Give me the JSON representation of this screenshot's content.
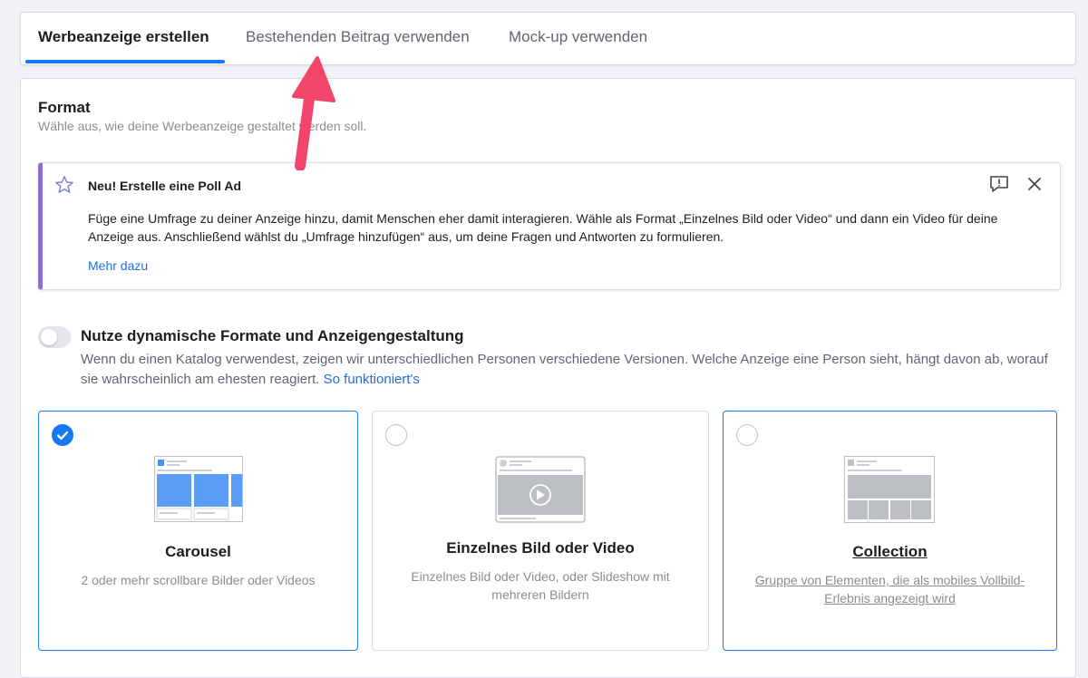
{
  "tabs": [
    {
      "label": "Werbeanzeige erstellen",
      "active": true
    },
    {
      "label": "Bestehenden Beitrag verwenden",
      "active": false
    },
    {
      "label": "Mock-up verwenden",
      "active": false
    }
  ],
  "format": {
    "title": "Format",
    "subtitle": "Wähle aus, wie deine Werbeanzeige gestaltet werden soll."
  },
  "notice": {
    "title": "Neu! Erstelle eine Poll Ad",
    "text": "Füge eine Umfrage zu deiner Anzeige hinzu, damit Menschen eher damit interagieren. Wähle als Format „Einzelnes Bild oder Video“ und dann ein Video für deine Anzeige aus. Anschließend wählst du „Umfrage hinzufügen“ aus, um deine Fragen und Antworten zu formulieren.",
    "link": "Mehr dazu",
    "accent_color": "#8c6fd6"
  },
  "dynamic": {
    "title": "Nutze dynamische Formate und Anzeigengestaltung",
    "description": "Wenn du einen Katalog verwendest, zeigen wir unterschiedlichen Personen verschiedene Versionen. Welche Anzeige eine Person sieht, hängt davon ab, worauf sie wahrscheinlich am ehesten reagiert.",
    "link": "So funktioniert's",
    "enabled": false
  },
  "options": [
    {
      "title": "Carousel",
      "description": "2 oder mehr scrollbare Bilder oder Videos",
      "selected": true,
      "icon": "carousel-thumbnail"
    },
    {
      "title": "Einzelnes Bild oder Video",
      "description": "Einzelnes Bild oder Video, oder Slideshow mit mehreren Bildern",
      "selected": false,
      "icon": "single-video-thumbnail"
    },
    {
      "title": "Collection",
      "description": "Gruppe von Elementen, die als mobiles Vollbild-Erlebnis angezeigt wird",
      "selected": false,
      "icon": "collection-thumbnail"
    }
  ],
  "colors": {
    "accent": "#1877f2",
    "arrow": "#f2456b",
    "link": "#216fdb"
  }
}
